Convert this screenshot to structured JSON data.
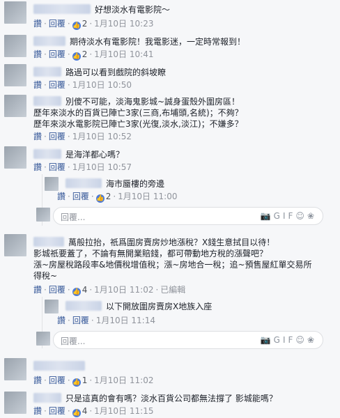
{
  "labels": {
    "like": "讚",
    "reply": "回覆",
    "edited": "已編輯",
    "reply_placeholder": "回覆..."
  },
  "comments": [
    {
      "text": "好想淡水有電影院～",
      "likes": "2",
      "time": "1月10日 10:23"
    },
    {
      "text": "期待淡水有電影院！我電影迷，一定時常報到！",
      "likes": "2",
      "time": "1月10日 10:41"
    },
    {
      "text": "路過可以看到戲院的斜坡瞭",
      "time": "1月10日 10:50"
    },
    {
      "lines": [
        "別傻不可能，淡海鬼影城~誠身蛋殼外圍房區！",
        "歷年來淡水的百貨已陣亡3家(三商,布埔頭,名統)；不夠？",
        "歷年來淡水電影院已陣亡3家(光復,淡水,淡江)；不嫌多？"
      ],
      "time": "1月10日 10:52"
    },
    {
      "text": "是海洋都心嗎？",
      "time": "1月10日 10:57"
    },
    {
      "reply_text": "海市蜃樓的旁邊",
      "likes": "2",
      "time": "1月10日 11:00"
    },
    {
      "lines": [
        "萬般拉抬，祇爲圍房賣房炒地漲稅？X錢生意拭目以待！",
        "影城祇要蓋了，不論有無開業賠錢，都可帶動地方稅的漲聲吧？",
        "漲~房屋稅路段率&地價稅增值稅；漲~房地合一稅；追~預售屋紅單交易所",
        "得稅~"
      ],
      "likes": "4",
      "time": "1月10日 11:02"
    },
    {
      "reply_text": "以下開放圍房賣房X地族入座",
      "time": "1月10日 11:14"
    },
    {
      "likes": "1",
      "time": "1月10日 11:02"
    },
    {
      "text": "只是這真的會有嗎？淡水百貨公司都無法撐了 影城能嗎？",
      "likes": "4",
      "time": "1月10日 11:15"
    }
  ]
}
